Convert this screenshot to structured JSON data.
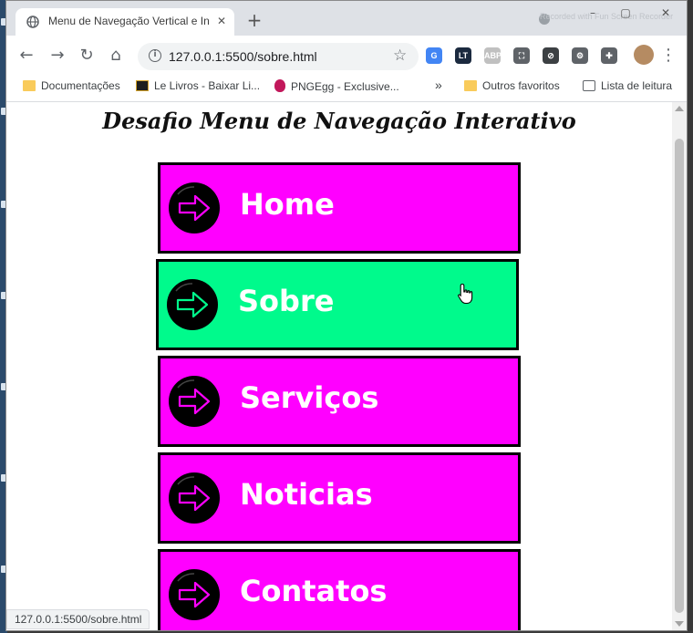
{
  "browser": {
    "tab": {
      "title": "Menu de Navegação Vertical e In",
      "close": "✕"
    },
    "new_tab": "+",
    "recording_badge": "Recorded with Fun Screen Recorder",
    "window_controls": {
      "minimize": "–",
      "maximize": "▢",
      "close": "✕"
    },
    "nav": {
      "back": "←",
      "forward": "→",
      "reload": "↻",
      "home": "⌂"
    },
    "address": {
      "url": "127.0.0.1:5500/sobre.html",
      "info": "i",
      "star": "☆"
    },
    "extensions": [
      {
        "name": "translate-icon",
        "label": "G",
        "color": "#4285f4"
      },
      {
        "name": "languagetool-icon",
        "label": "LT",
        "color": "#1b2a3f"
      },
      {
        "name": "adblock-icon",
        "label": "ABP",
        "color": "#c0c0c0"
      },
      {
        "name": "screenshot-icon",
        "label": "⛶",
        "color": "#5f6368"
      },
      {
        "name": "block-icon",
        "label": "⊘",
        "color": "#3c4043"
      },
      {
        "name": "settings-gear-icon",
        "label": "⚙",
        "color": "#5f6368"
      },
      {
        "name": "puzzle-extensions-icon",
        "label": "✚",
        "color": "#5f6368"
      }
    ],
    "menu_dots": "⋮",
    "bookmarks": [
      {
        "label": "Documentações",
        "icon": "folder-icon"
      },
      {
        "label": "Le Livros - Baixar Li...",
        "icon": "book-icon"
      },
      {
        "label": "PNGEgg - Exclusive...",
        "icon": "pngegg-icon"
      }
    ],
    "bookmarks_more": "»",
    "other_bookmarks": "Outros favoritos",
    "reading_list": "Lista de leitura",
    "status_url": "127.0.0.1:5500/sobre.html"
  },
  "page": {
    "title": "Desafio Menu de Navegação Interativo",
    "menu": [
      {
        "label": "Home",
        "active": false
      },
      {
        "label": "Sobre",
        "active": true
      },
      {
        "label": "Serviços",
        "active": false
      },
      {
        "label": "Noticias",
        "active": false
      },
      {
        "label": "Contatos",
        "active": false
      }
    ]
  },
  "colors": {
    "menu_bg": "#ff00ff",
    "menu_active_bg": "#00fa8c",
    "icon_circle": "#000000",
    "arrow_default": "#ff00ff",
    "arrow_active": "#00fa8c"
  }
}
